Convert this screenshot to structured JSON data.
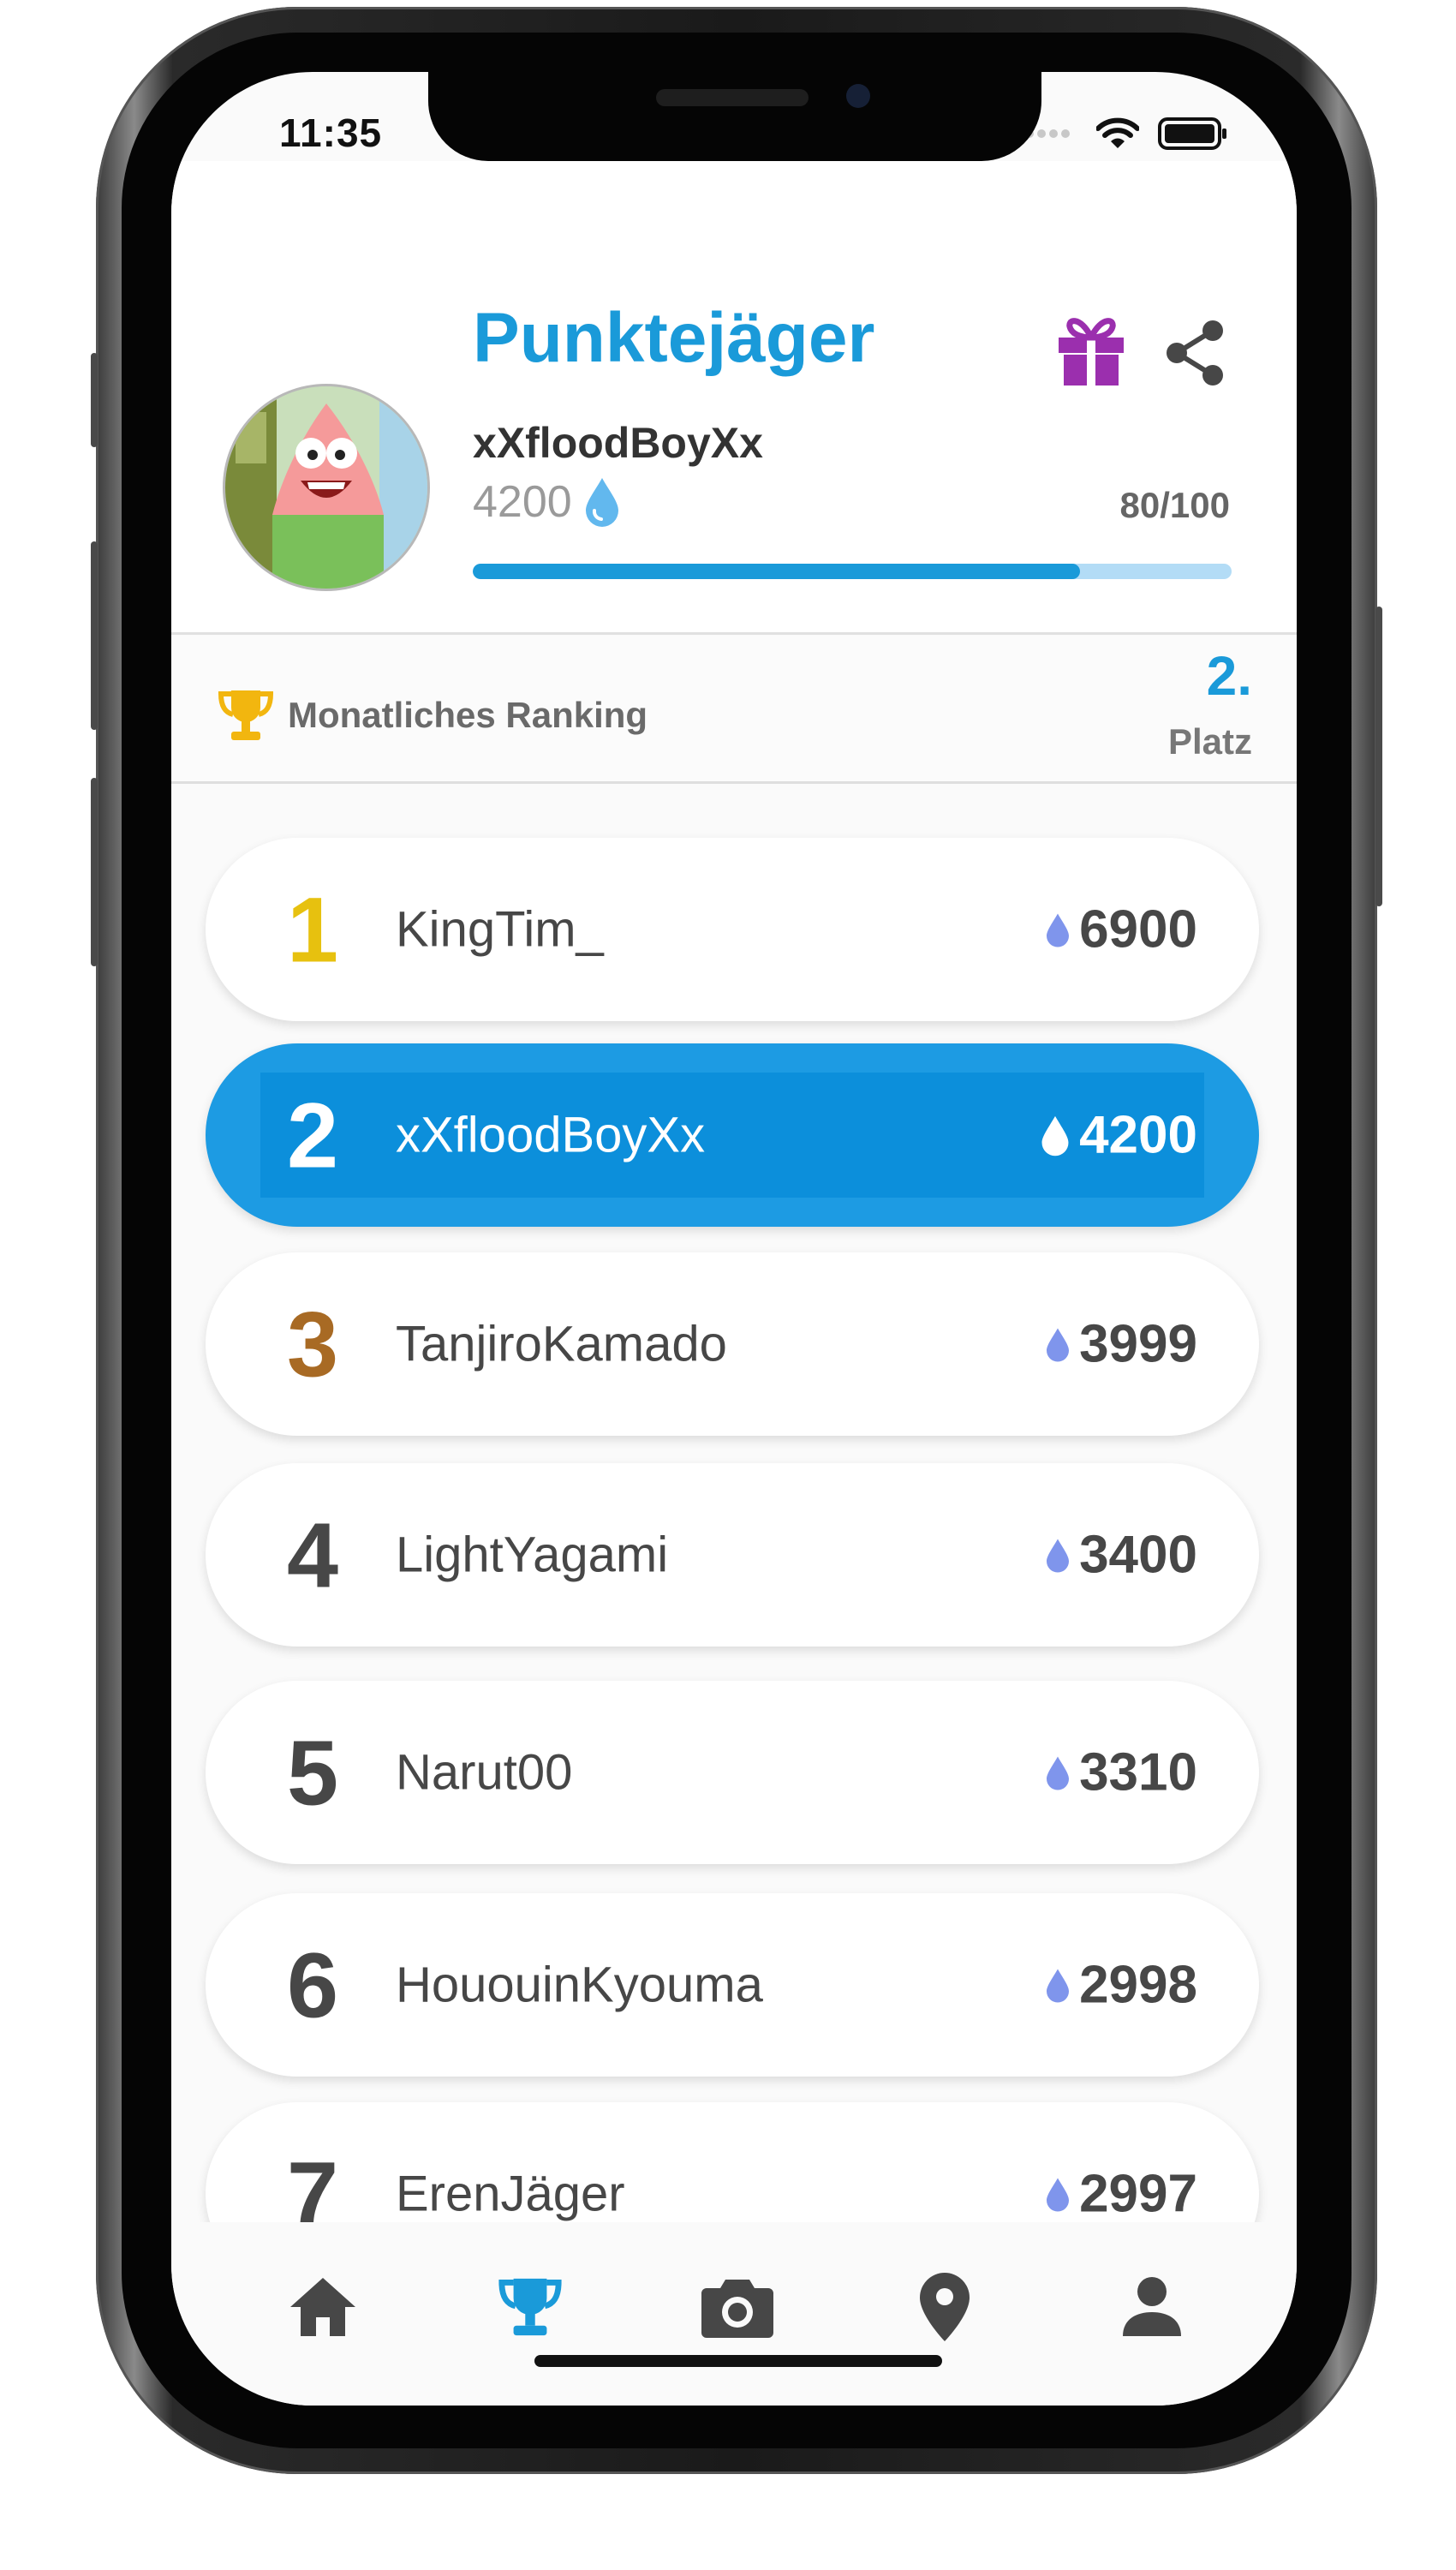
{
  "status_bar": {
    "time": "11:35"
  },
  "header": {
    "app_title": "Punktejäger",
    "user_name": "xXfloodBoyXx",
    "points": "4200",
    "progress_label": "80/100",
    "progress_fraction": 0.8,
    "gift_icon": "gift-icon",
    "share_icon": "share-icon",
    "avatar_icon": "avatar-image"
  },
  "ranking": {
    "title": "Monatliches Ranking",
    "place_number": "2.",
    "place_label": "Platz",
    "trophy_color": "#f2b60f"
  },
  "leaderboard": [
    {
      "rank": "1",
      "name": "KingTim_",
      "score": "6900",
      "rank_color": "#e7c10f",
      "active": false
    },
    {
      "rank": "2",
      "name": "xXfloodBoyXx",
      "score": "4200",
      "rank_color": "#ffffff",
      "active": true
    },
    {
      "rank": "3",
      "name": "TanjiroKamado",
      "score": "3999",
      "rank_color": "#a86a24",
      "active": false
    },
    {
      "rank": "4",
      "name": "LightYagami",
      "score": "3400",
      "rank_color": "#474747",
      "active": false
    },
    {
      "rank": "5",
      "name": "Narut00",
      "score": "3310",
      "rank_color": "#474747",
      "active": false
    },
    {
      "rank": "6",
      "name": "HououinKyouma",
      "score": "2998",
      "rank_color": "#474747",
      "active": false
    },
    {
      "rank": "7",
      "name": "ErenJäger",
      "score": "2997",
      "rank_color": "#474747",
      "active": false
    }
  ],
  "bottom_nav": [
    {
      "icon": "home-icon",
      "active": false
    },
    {
      "icon": "trophy-icon",
      "active": true
    },
    {
      "icon": "camera-icon",
      "active": false
    },
    {
      "icon": "location-pin-icon",
      "active": false
    },
    {
      "icon": "person-icon",
      "active": false
    }
  ],
  "colors": {
    "accent": "#1a9ad9",
    "active_row": "#1d9be3",
    "drop": "#7f95ec",
    "gift": "#9b2fae",
    "text": "#474747"
  }
}
